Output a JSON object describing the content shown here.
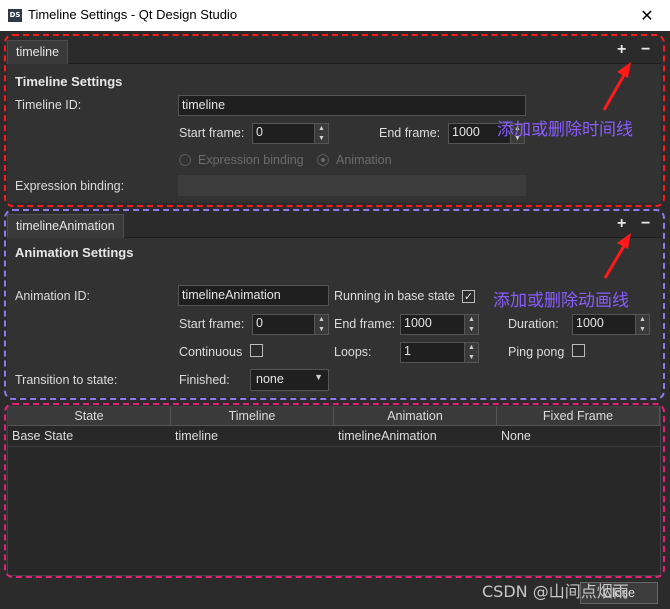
{
  "window": {
    "title": "Timeline Settings - Qt Design Studio",
    "icon_text": "DS",
    "close_glyph": "✕"
  },
  "timeline_panel": {
    "tab": "timeline",
    "add": "+",
    "remove": "−",
    "section_title": "Timeline Settings",
    "timeline_id_label": "Timeline ID:",
    "timeline_id_value": "timeline",
    "start_frame_label": "Start frame:",
    "start_frame_value": "0",
    "end_frame_label": "End frame:",
    "end_frame_value": "1000",
    "expression_binding_radio": "Expression binding",
    "animation_radio": "Animation",
    "expression_binding_label": "Expression binding:",
    "expression_binding_value": ""
  },
  "animation_panel": {
    "tab": "timelineAnimation",
    "add": "+",
    "remove": "−",
    "section_title": "Animation Settings",
    "animation_id_label": "Animation ID:",
    "animation_id_value": "timelineAnimation",
    "running_label": "Running in base state",
    "running_checked": true,
    "start_frame_label": "Start frame:",
    "start_frame_value": "0",
    "end_frame_label": "End frame:",
    "end_frame_value": "1000",
    "duration_label": "Duration:",
    "duration_value": "1000",
    "continuous_label": "Continuous",
    "continuous_checked": false,
    "loops_label": "Loops:",
    "loops_value": "1",
    "pingpong_label": "Ping pong",
    "pingpong_checked": false,
    "transition_label": "Transition to state:",
    "finished_label": "Finished:",
    "finished_value": "none"
  },
  "table": {
    "headers": [
      "State",
      "Timeline",
      "Animation",
      "Fixed Frame"
    ],
    "rows": [
      [
        "Base State",
        "timeline",
        "timelineAnimation",
        "None"
      ]
    ]
  },
  "annotations": {
    "timeline_note": "添加或删除时间线",
    "animation_note": "添加或删除动画线",
    "timeline_color": "#ff1a1a",
    "animation_color": "#8c7cf0",
    "table_color": "#e8207a"
  },
  "footer": {
    "watermark": "CSDN @山间点烟雨",
    "close_button": "Close"
  },
  "icons": {
    "checkmark": "✓",
    "spin_up": "▲",
    "spin_down": "▼",
    "caret": "▼"
  }
}
